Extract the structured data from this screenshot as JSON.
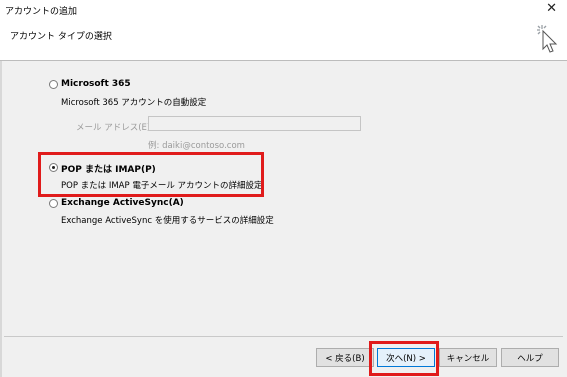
{
  "window": {
    "title": "アカウントの追加",
    "close_glyph": "✕",
    "header": "アカウント タイプの選択"
  },
  "options": [
    {
      "title": "Microsoft 365",
      "desc": "Microsoft 365 アカウントの自動設定",
      "checked": false
    },
    {
      "title": "POP または IMAP(P)",
      "desc": "POP または IMAP 電子メール アカウントの詳細設定",
      "checked": true
    },
    {
      "title": "Exchange ActiveSync(A)",
      "desc": "Exchange ActiveSync を使用するサービスの詳細設定",
      "checked": false
    }
  ],
  "email_field": {
    "label": "メール アドレス(E):",
    "value": "",
    "example": "例: daiki@contoso.com"
  },
  "buttons": {
    "back": "< 戻る(B)",
    "next": "次へ(N) >",
    "cancel": "キャンセル",
    "help": "ヘルプ"
  },
  "highlight_color": "#e01b1b"
}
